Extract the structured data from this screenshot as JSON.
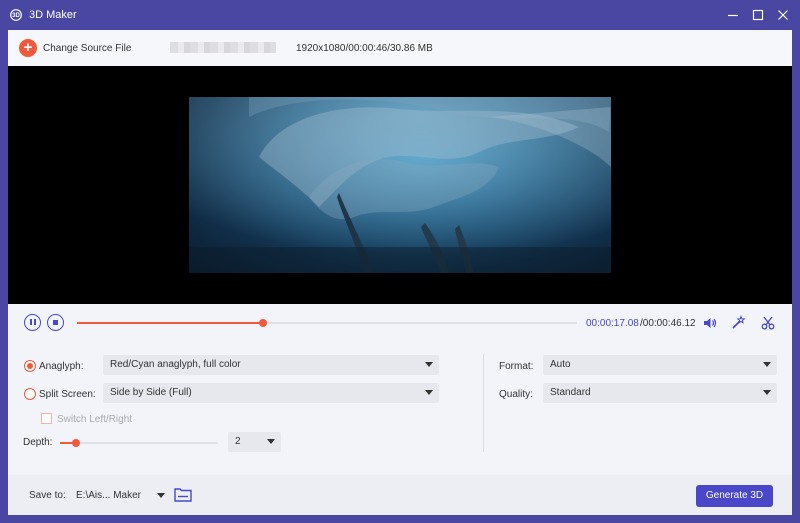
{
  "window": {
    "title": "3D Maker",
    "logo_icon": "3d-maker-logo-icon",
    "controls": [
      "minimize-icon",
      "maximize-icon",
      "close-icon"
    ]
  },
  "source_bar": {
    "change_source_label": "Change Source File",
    "file_info": "1920x1080/00:00:46/30.86 MB"
  },
  "playback": {
    "current_time": "00:00:17.08",
    "total_time": "/00:00:46.12",
    "progress": 0.372,
    "icons": [
      "pause-icon",
      "stop-icon",
      "volume-icon",
      "magic-wand-icon",
      "scissors-icon"
    ]
  },
  "settings": {
    "anaglyph": {
      "label": "Anaglyph:",
      "checked": true,
      "value": "Red/Cyan anaglyph, full color"
    },
    "split_screen": {
      "label": "Split Screen:",
      "checked": false,
      "value": "Side by Side (Full)"
    },
    "switch_lr": {
      "label": "Switch Left/Right",
      "checked": false,
      "disabled": true
    },
    "depth": {
      "label": "Depth:",
      "value": "2",
      "level": 0.1
    },
    "format": {
      "label": "Format:",
      "value": "Auto"
    },
    "quality": {
      "label": "Quality:",
      "value": "Standard"
    }
  },
  "footer": {
    "save_to_label": "Save to:",
    "save_path": "E:\\Ais... Maker",
    "generate_label": "Generate 3D"
  },
  "colors": {
    "titlebar": "#4a47a3",
    "accent": "#4a47c8",
    "orange": "#f05a3c"
  }
}
